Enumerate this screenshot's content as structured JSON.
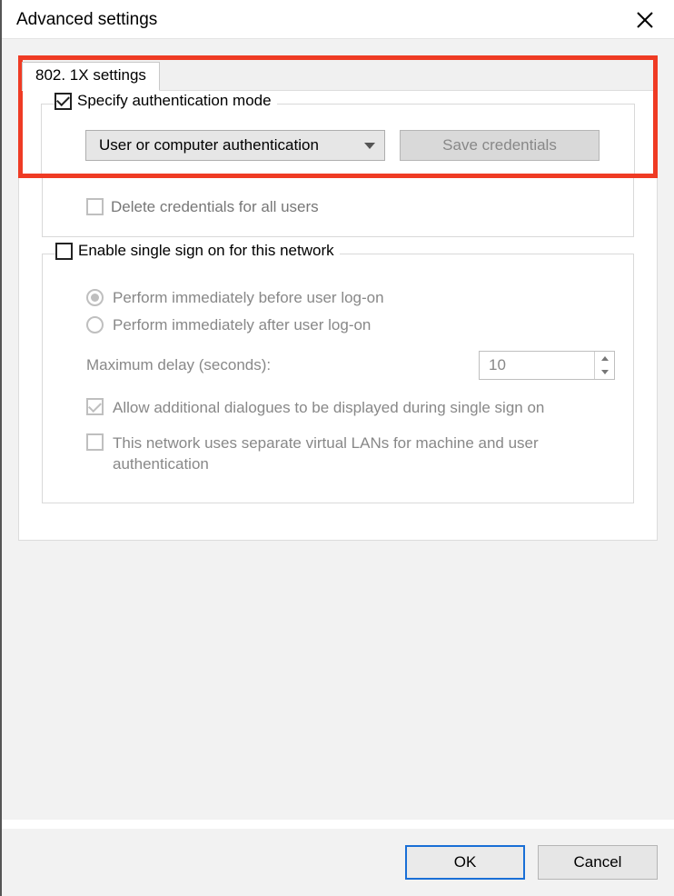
{
  "window": {
    "title": "Advanced settings"
  },
  "tab": {
    "label": "802. 1X settings"
  },
  "auth_mode": {
    "specify_label": "Specify authentication mode",
    "specify_checked": true,
    "dropdown_value": "User or computer authentication",
    "save_credentials_label": "Save credentials",
    "delete_credentials_label": "Delete credentials for all users"
  },
  "sso": {
    "enable_label": "Enable single sign on for this network",
    "enable_checked": false,
    "before_logon_label": "Perform immediately before user log-on",
    "after_logon_label": "Perform immediately after user log-on",
    "selected_option": "before",
    "delay_label": "Maximum delay (seconds):",
    "delay_value": "10",
    "allow_dialogs_label": "Allow additional dialogues to be displayed during single sign on",
    "allow_dialogs_checked": true,
    "separate_vlan_label": "This network uses separate virtual LANs for machine and user authentication",
    "separate_vlan_checked": false
  },
  "footer": {
    "ok_label": "OK",
    "cancel_label": "Cancel"
  }
}
